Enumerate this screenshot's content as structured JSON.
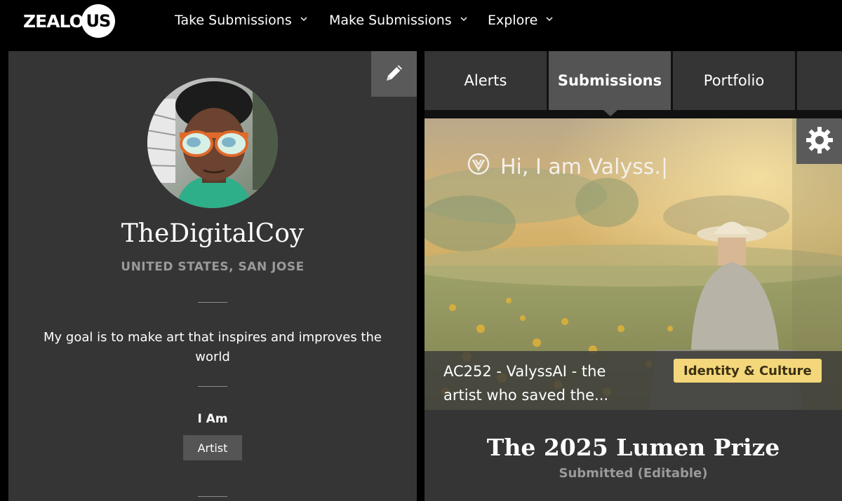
{
  "brand": {
    "logo_word": "ZEALO",
    "logo_circle": "US"
  },
  "nav": {
    "items": [
      {
        "label": "Take Submissions",
        "icon": "chevron-down-icon"
      },
      {
        "label": "Make Submissions",
        "icon": "chevron-down-icon"
      },
      {
        "label": "Explore",
        "icon": "chevron-down-icon"
      }
    ]
  },
  "profile": {
    "edit_icon": "pencil-icon",
    "username": "TheDigitalCoy",
    "location": "UNITED STATES, SAN JOSE",
    "bio": "My goal is to make art that inspires and improves the world",
    "iam_label": "I Am",
    "role": "Artist"
  },
  "tabs": [
    {
      "label": "Alerts",
      "active": false
    },
    {
      "label": "Submissions",
      "active": true
    },
    {
      "label": "Portfolio",
      "active": false
    }
  ],
  "submission": {
    "settings_icon": "gear-icon",
    "image_text": "Hi, I am Valyss.|",
    "image_logo_icon": "valyss-logo-icon",
    "caption": "AC252 - ValyssAI - the artist who saved the...",
    "category": "Identity & Culture",
    "prize": "The 2025 Lumen Prize",
    "status": "Submitted (Editable)"
  },
  "colors": {
    "background": "#000000",
    "panel": "#353535",
    "active_tab": "#545454",
    "badge": "#f4d77a",
    "muted_text": "#9a9a9a"
  }
}
